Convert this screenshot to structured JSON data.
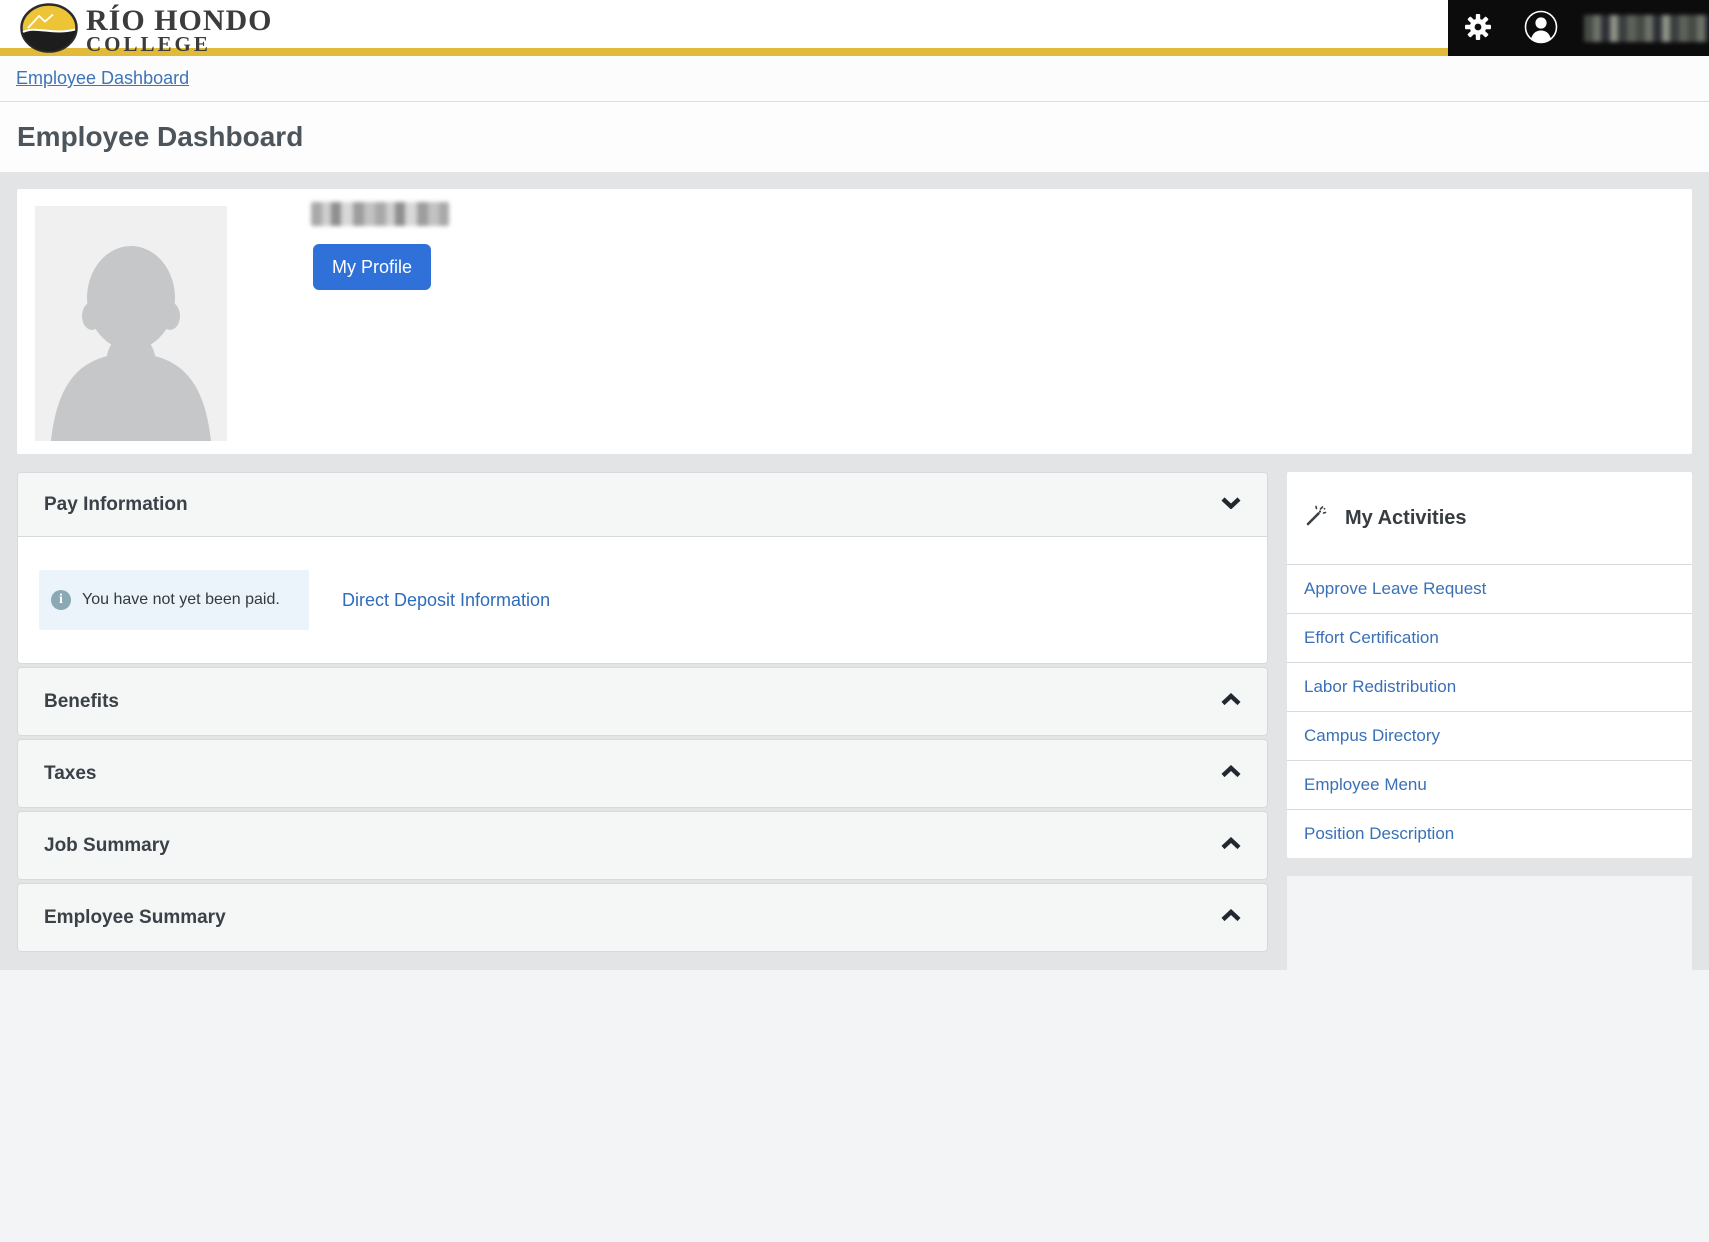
{
  "header": {
    "logo": {
      "line1": "RÍO HONDO",
      "line2": "COLLEGE"
    },
    "user_name": "(redacted name)",
    "settings_icon": "gear-icon",
    "user_icon": "person-icon"
  },
  "breadcrumb": {
    "label": "Employee Dashboard"
  },
  "page": {
    "title": "Employee Dashboard"
  },
  "profile": {
    "name": "(redacted name)",
    "my_profile_button": "My Profile"
  },
  "pay_information": {
    "label": "Pay Information",
    "state": "expanded",
    "alert_text": "You have not yet been paid.",
    "link_label": "Direct Deposit Information"
  },
  "accordion": {
    "sections": [
      {
        "label": "Benefits",
        "state": "collapsed"
      },
      {
        "label": "Taxes",
        "state": "collapsed"
      },
      {
        "label": "Job Summary",
        "state": "collapsed"
      },
      {
        "label": "Employee Summary",
        "state": "collapsed"
      }
    ]
  },
  "my_activities": {
    "title": "My Activities",
    "icon": "magic-wand-icon",
    "links": [
      "Approve Leave Request",
      "Effort Certification",
      "Labor Redistribution",
      "Campus Directory",
      "Employee Menu",
      "Position Description"
    ]
  },
  "colors": {
    "brand_gold": "#e0ba38",
    "header_black": "#0c0c0c",
    "button_blue": "#2f70d9",
    "link_blue": "#3a70b6",
    "alert_bg": "#eaf4fa",
    "wrapper_gray": "#e3e4e5"
  }
}
